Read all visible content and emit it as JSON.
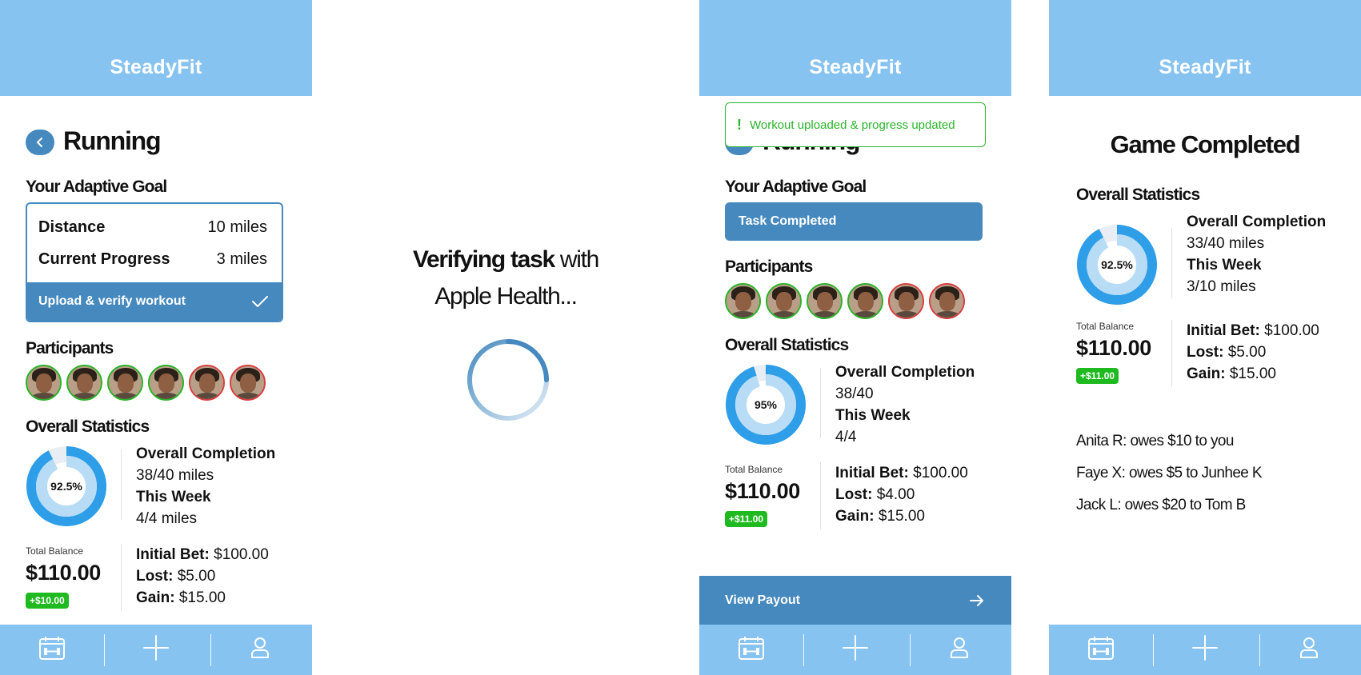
{
  "app": {
    "title": "SteadyFit"
  },
  "colors": {
    "header": "#87c3f1",
    "primary": "#4689be",
    "success": "#1fba1f",
    "danger": "#d74040",
    "donut_main": "#2e9ee8",
    "donut_light": "#b8dcf6"
  },
  "screen1": {
    "title": "Running",
    "goal_heading": "Your Adaptive Goal",
    "goal": [
      {
        "label": "Distance",
        "value": "10 miles"
      },
      {
        "label": "Current Progress",
        "value": "3 miles"
      }
    ],
    "action_label": "Upload & verify workout",
    "participants_heading": "Participants",
    "participants": [
      "green",
      "green",
      "green",
      "green",
      "red",
      "red"
    ],
    "stats_heading": "Overall Statistics",
    "donut": {
      "percent": 92.5,
      "label": "92.5%"
    },
    "overall_completion_label": "Overall Completion",
    "overall_completion_value": "38/40 miles",
    "this_week_label": "This Week",
    "this_week_value": "4/4 miles",
    "total_balance_label": "Total Balance",
    "total_balance": "$110.00",
    "balance_change": "+$10.00",
    "initial_bet_label": "Initial Bet:",
    "initial_bet": "$100.00",
    "lost_label": "Lost:",
    "lost": "$5.00",
    "gain_label": "Gain:",
    "gain": "$15.00"
  },
  "screen2": {
    "verify_bold": "Verifying task",
    "verify_rest": " with",
    "verify_line2": "Apple Health...",
    "spinner_progress": 0.55
  },
  "screen3": {
    "title": "Running",
    "toast": "Workout uploaded & progress updated",
    "toast_icon": "!",
    "goal_heading": "Your Adaptive Goal",
    "task_status": "Task Completed",
    "participants_heading": "Participants",
    "participants": [
      "green",
      "green",
      "green",
      "green",
      "red",
      "red"
    ],
    "stats_heading": "Overall Statistics",
    "donut": {
      "percent": 95,
      "label": "95%"
    },
    "overall_completion_label": "Overall Completion",
    "overall_completion_value": "38/40",
    "this_week_label": "This Week",
    "this_week_value": "4/4",
    "total_balance_label": "Total Balance",
    "total_balance": "$110.00",
    "balance_change": "+$11.00",
    "initial_bet_label": "Initial Bet:",
    "initial_bet": "$100.00",
    "lost_label": "Lost:",
    "lost": "$4.00",
    "gain_label": "Gain:",
    "gain": "$15.00",
    "payout_label": "View Payout"
  },
  "screen4": {
    "title": "Game Completed",
    "stats_heading": "Overall Statistics",
    "donut": {
      "percent": 92.5,
      "label": "92.5%"
    },
    "overall_completion_label": "Overall Completion",
    "overall_completion_value": "33/40 miles",
    "this_week_label": "This Week",
    "this_week_value": "3/10 miles",
    "total_balance_label": "Total Balance",
    "total_balance": "$110.00",
    "balance_change": "+$11.00",
    "initial_bet_label": "Initial Bet:",
    "initial_bet": "$100.00",
    "lost_label": "Lost:",
    "lost": "$5.00",
    "gain_label": "Gain:",
    "gain": "$15.00",
    "owes": [
      "Anita R: owes $10 to you",
      "Faye X: owes $5 to Junhee K",
      "Jack L: owes $20 to Tom B"
    ]
  },
  "tabbar": {
    "icons": [
      "calendar-fitness-icon",
      "plus-icon",
      "profile-icon"
    ]
  }
}
